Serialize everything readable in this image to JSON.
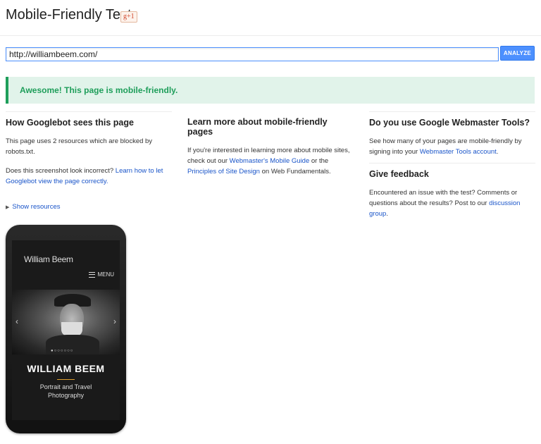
{
  "header": {
    "title": "Mobile-Friendly Test",
    "gplus_label": "g+1"
  },
  "form": {
    "url_value": "http://williambeem.com/",
    "analyze_label": "ANALYZE"
  },
  "result": {
    "banner": "Awesome! This page is mobile-friendly."
  },
  "googlebot": {
    "heading": "How Googlebot sees this page",
    "p1": "This page uses 2 resources which are blocked by robots.txt.",
    "p2_text": "Does this screenshot look incorrect? ",
    "p2_link": "Learn how to let Googlebot view the page correctly.",
    "show_resources": "Show resources"
  },
  "learn": {
    "heading": "Learn more about mobile-friendly pages",
    "t1": "If you're interested in learning more about mobile sites, check out our ",
    "link1": "Webmaster's Mobile Guide",
    "t2": " or the ",
    "link2": "Principles of Site Design",
    "t3": " on Web Fundamentals."
  },
  "wmt": {
    "heading": "Do you use Google Webmaster Tools?",
    "t1": "See how many of your pages are mobile-friendly by signing into your ",
    "link1": "Webmaster Tools account",
    "t2": "."
  },
  "feedback": {
    "heading": "Give feedback",
    "t1": "Encountered an issue with the test? Comments or questions about the results? Post to our ",
    "link1": "discussion group",
    "t2": "."
  },
  "phone": {
    "site_name": "William Beem",
    "menu_label": "MENU",
    "hero_name": "WILLIAM BEEM",
    "tagline_line1": "Portrait and Travel",
    "tagline_line2": "Photography",
    "left_arrow": "‹",
    "right_arrow": "›",
    "dots": "●○○○○○○"
  }
}
